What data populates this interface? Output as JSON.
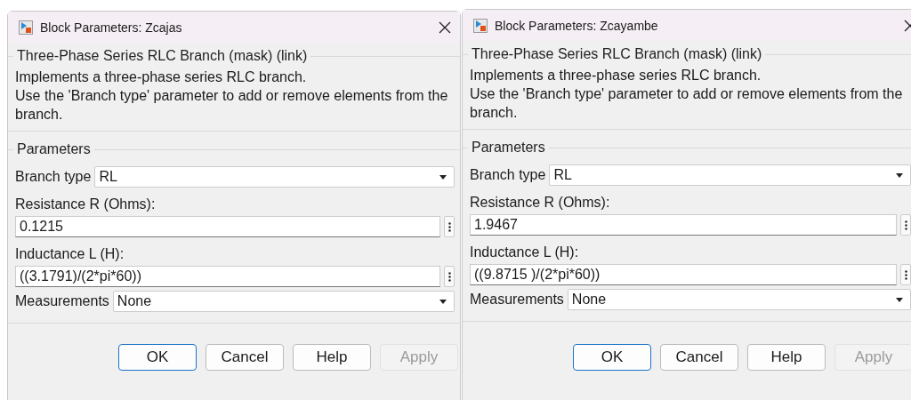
{
  "dialogs": [
    {
      "title": "Block Parameters: Zcajas",
      "mask_title": "Three-Phase Series RLC Branch (mask) (link)",
      "description": [
        "Implements a three-phase series RLC branch.",
        "Use the 'Branch type' parameter to add or remove elements from the branch."
      ],
      "parameters_title": "Parameters",
      "branch_type": {
        "label": "Branch type",
        "value": "RL"
      },
      "resistance": {
        "label": "Resistance R (Ohms):",
        "value": "0.1215"
      },
      "inductance": {
        "label": "Inductance L (H):",
        "value": "((3.1791)/(2*pi*60))"
      },
      "measurements": {
        "label": "Measurements",
        "value": "None"
      },
      "buttons": [
        {
          "label": "OK",
          "default": true,
          "disabled": false
        },
        {
          "label": "Cancel",
          "default": false,
          "disabled": false
        },
        {
          "label": "Help",
          "default": false,
          "disabled": false
        },
        {
          "label": "Apply",
          "default": false,
          "disabled": true
        }
      ]
    },
    {
      "title": "Block Parameters: Zcayambe",
      "mask_title": "Three-Phase Series RLC Branch (mask) (link)",
      "description": [
        "Implements a three-phase series RLC branch.",
        "Use the 'Branch type' parameter to add or remove elements from the branch."
      ],
      "parameters_title": "Parameters",
      "branch_type": {
        "label": "Branch type",
        "value": "RL"
      },
      "resistance": {
        "label": "Resistance R (Ohms):",
        "value": "1.9467"
      },
      "inductance": {
        "label": "Inductance L (H):",
        "value": "((9.8715 )/(2*pi*60))"
      },
      "measurements": {
        "label": "Measurements",
        "value": "None"
      },
      "buttons": [
        {
          "label": "OK",
          "default": true,
          "disabled": false
        },
        {
          "label": "Cancel",
          "default": false,
          "disabled": false
        },
        {
          "label": "Help",
          "default": false,
          "disabled": false
        },
        {
          "label": "Apply",
          "default": false,
          "disabled": true
        }
      ]
    }
  ]
}
